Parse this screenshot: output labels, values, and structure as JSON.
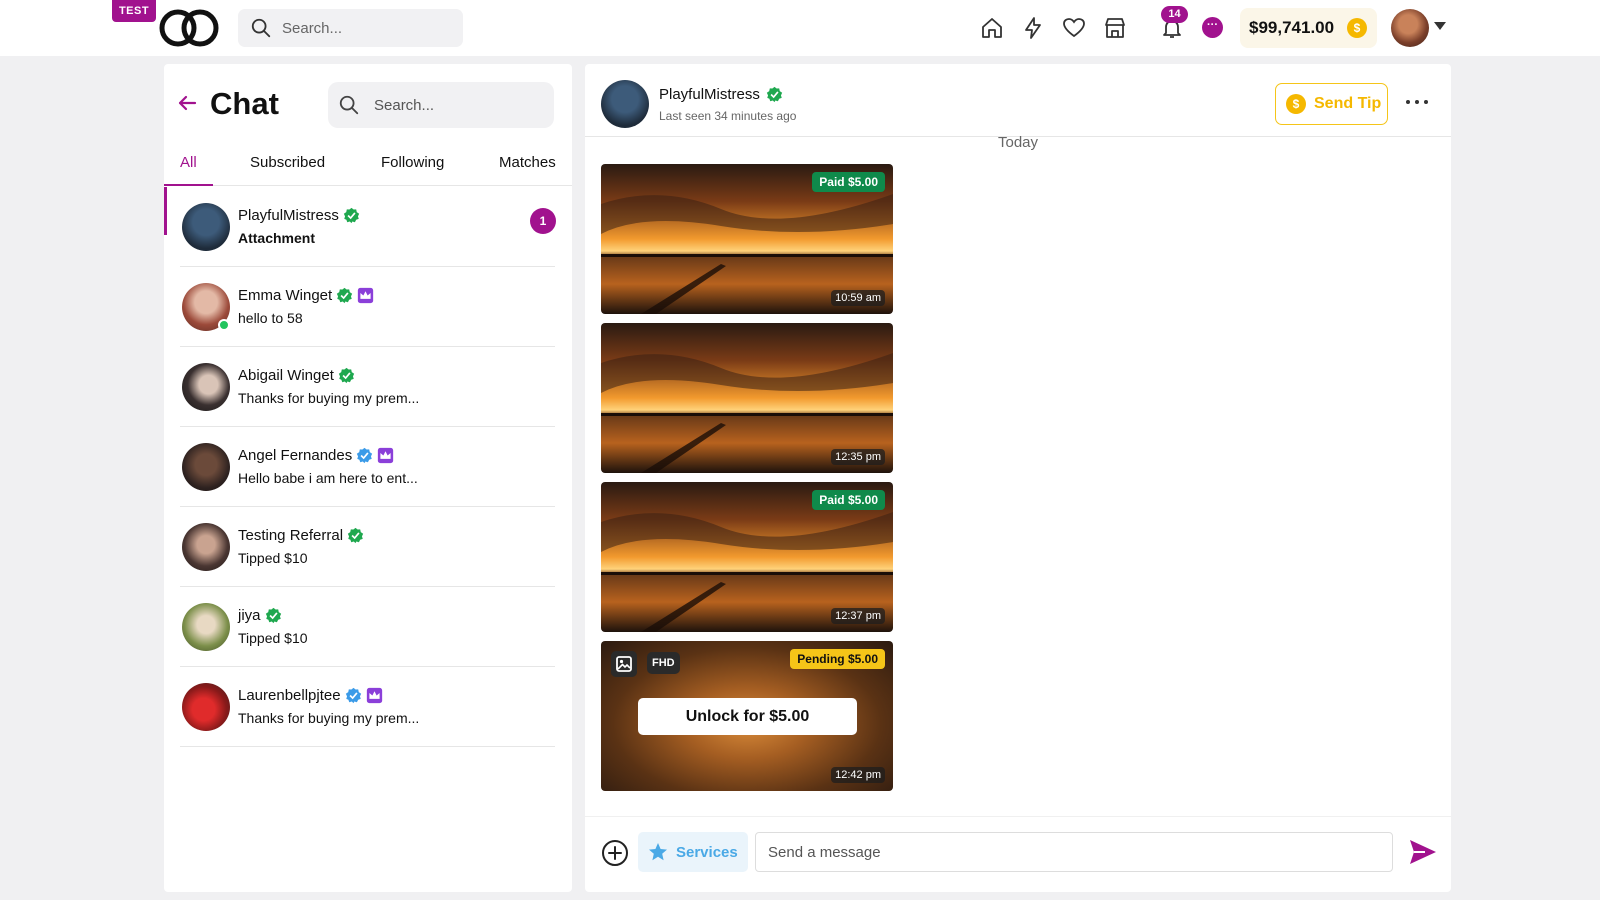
{
  "topbar": {
    "env_badge": "TEST",
    "search_placeholder": "Search...",
    "notification_count": "14",
    "messages_glyph": "···",
    "wallet_balance": "$99,741.00",
    "coin_symbol": "$",
    "nav_icons": [
      "home-icon",
      "lightning-icon",
      "heart-icon",
      "store-icon",
      "bell-icon",
      "message-icon"
    ]
  },
  "left": {
    "title": "Chat",
    "search_placeholder": "Search...",
    "tabs": [
      {
        "label": "All",
        "active": true
      },
      {
        "label": "Subscribed",
        "active": false
      },
      {
        "label": "Following",
        "active": false
      },
      {
        "label": "Matches",
        "active": false
      }
    ],
    "conversations": [
      {
        "name": "PlayfulMistress",
        "preview": "Attachment",
        "verified": "green",
        "crown": false,
        "unread": "1",
        "online": false,
        "preview_bold": true
      },
      {
        "name": "Emma Winget",
        "preview": "hello to 58",
        "verified": "green",
        "crown": true,
        "unread": "",
        "online": true,
        "preview_bold": false
      },
      {
        "name": "Abigail Winget",
        "preview": "Thanks for buying my prem...",
        "verified": "green",
        "crown": false,
        "unread": "",
        "online": false,
        "preview_bold": false
      },
      {
        "name": "Angel Fernandes",
        "preview": "Hello babe i am here to ent...",
        "verified": "blue",
        "crown": true,
        "unread": "",
        "online": false,
        "preview_bold": false
      },
      {
        "name": "Testing Referral",
        "preview": "Tipped $10",
        "verified": "green",
        "crown": false,
        "unread": "",
        "online": false,
        "preview_bold": false
      },
      {
        "name": "jiya",
        "preview": "Tipped $10",
        "verified": "green",
        "crown": false,
        "unread": "",
        "online": false,
        "preview_bold": false
      },
      {
        "name": "Laurenbellpjtee",
        "preview": "Thanks for buying my prem...",
        "verified": "blue",
        "crown": true,
        "unread": "",
        "online": false,
        "preview_bold": false
      }
    ]
  },
  "chat": {
    "contact_name": "PlayfulMistress",
    "last_seen": "Last seen 34 minutes ago",
    "tip_label": "Send Tip",
    "tip_coin": "$",
    "day_label": "Today",
    "messages": [
      {
        "status": "Paid $5.00",
        "time": "10:59 am",
        "locked": false
      },
      {
        "status": "",
        "time": "12:35 pm",
        "locked": false
      },
      {
        "status": "Paid $5.00",
        "time": "12:37 pm",
        "locked": false
      },
      {
        "status": "Pending $5.00",
        "time": "12:42 pm",
        "locked": true,
        "quality": "FHD",
        "unlock_label": "Unlock for $5.00"
      }
    ]
  },
  "composer": {
    "services_label": "Services",
    "input_placeholder": "Send a message"
  },
  "colors": {
    "brand": "#a1128e",
    "paid": "#0f8a4b",
    "pending": "#f5c518",
    "verified_green": "#1fa84f",
    "verified_blue": "#3b9be8",
    "crown_purple": "#8b3fd9",
    "services_blue": "#4aa9e6"
  }
}
